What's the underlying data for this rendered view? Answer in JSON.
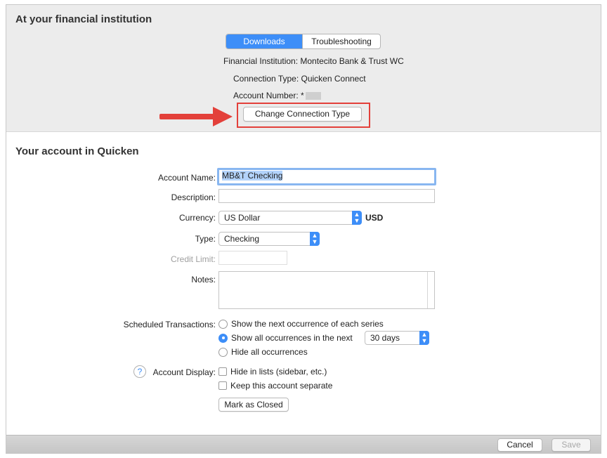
{
  "institution": {
    "title": "At your financial institution",
    "tabs": [
      {
        "label": "Downloads",
        "active": true
      },
      {
        "label": "Troubleshooting",
        "active": false
      }
    ],
    "financial_institution": "Financial Institution: Montecito Bank & Trust WC",
    "connection_type": "Connection Type: Quicken Connect",
    "account_number_label": "Account Number: *",
    "change_button": "Change Connection Type",
    "highlight_color": "#e3403a"
  },
  "account": {
    "title": "Your account in Quicken",
    "name_label": "Account Name:",
    "name_value": "MB&T Checking",
    "description_label": "Description:",
    "description_value": "",
    "currency_label": "Currency:",
    "currency_value": "US Dollar",
    "currency_code": "USD",
    "type_label": "Type:",
    "type_value": "Checking",
    "credit_limit_label": "Credit Limit:",
    "credit_limit_value": "",
    "notes_label": "Notes:",
    "notes_value": ""
  },
  "scheduled": {
    "label": "Scheduled Transactions:",
    "options": [
      {
        "label": "Show the next occurrence of each series",
        "selected": false
      },
      {
        "label": "Show all occurrences in the next",
        "selected": true
      },
      {
        "label": "Hide all occurrences",
        "selected": false
      }
    ],
    "period_value": "30 days"
  },
  "display": {
    "help_icon": "?",
    "label": "Account Display:",
    "options": [
      {
        "label": "Hide in lists (sidebar, etc.)",
        "checked": false
      },
      {
        "label": "Keep this account separate",
        "checked": false
      }
    ],
    "mark_closed": "Mark as Closed"
  },
  "footer": {
    "cancel": "Cancel",
    "save": "Save"
  },
  "colors": {
    "accent": "#3d8ef8",
    "header_bg": "#ececec"
  }
}
